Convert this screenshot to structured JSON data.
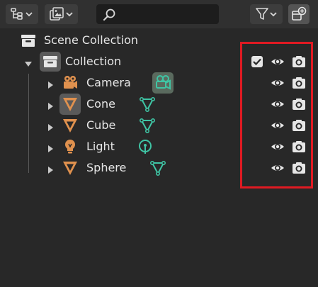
{
  "header": {
    "display_mode_icon": "outliner-tree-icon",
    "filter_icon": "funnel-icon",
    "new_collection_icon": "new-collection-icon",
    "search": {
      "value": "",
      "placeholder": ""
    }
  },
  "tree": {
    "scene": {
      "label": "Scene Collection",
      "icon": "scene-collection-icon"
    },
    "collection": {
      "label": "Collection",
      "icon": "collection-box-icon",
      "checkbox_checked": true
    },
    "objects": [
      {
        "label": "Camera",
        "object_icon": "camera-object-icon",
        "data_icon": "camera-data-icon",
        "data_active": true
      },
      {
        "label": "Cone",
        "object_icon": "mesh-object-icon",
        "data_icon": "mesh-data-icon",
        "data_active": false
      },
      {
        "label": "Cube",
        "object_icon": "mesh-object-icon",
        "data_icon": "mesh-data-icon",
        "data_active": false
      },
      {
        "label": "Light",
        "object_icon": "light-object-icon",
        "data_icon": "light-data-icon",
        "data_active": false
      },
      {
        "label": "Sphere",
        "object_icon": "mesh-object-icon",
        "data_icon": "mesh-data-icon",
        "data_active": false
      }
    ]
  },
  "colors": {
    "background": "#282828",
    "header": "#303030",
    "object_orange": "#e0914e",
    "data_green": "#3fc4a4",
    "highlight_red": "#e01a22"
  }
}
